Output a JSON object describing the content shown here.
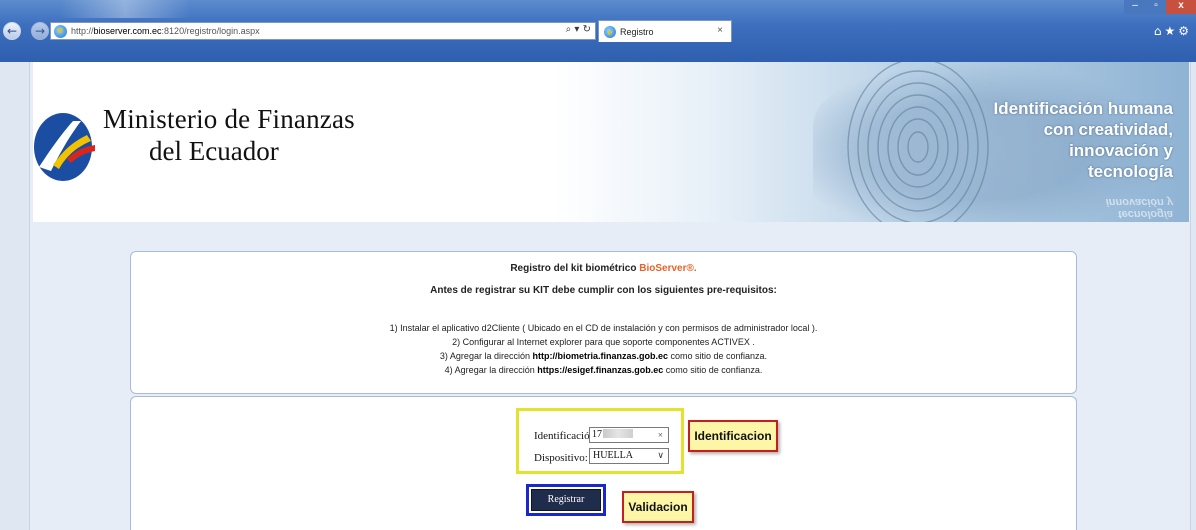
{
  "browser": {
    "url_prefix": "http://",
    "url_host": "bioserver.com.ec",
    "url_path": ":8120/registro/login.aspx",
    "address_tools": "⌕ ▾ ↻",
    "tab_title": "Registro",
    "tab_close": "×",
    "win_min": "–",
    "win_max": "▫",
    "win_close": "x",
    "right_icons": "⌂★⚙",
    "back": "←",
    "forward": "→",
    "ie_glyph": "e"
  },
  "banner": {
    "org_line1": "Ministerio de Finanzas",
    "org_line2": "del Ecuador",
    "tagline": [
      "Identificación humana",
      "con creatividad,",
      "innovación  y",
      "tecnología"
    ]
  },
  "info": {
    "title_prefix": "Registro del kit biométrico ",
    "title_brand": "BioServer®.",
    "subtitle": "Antes de registrar su KIT debe cumplir con los siguientes pre-requisitos:",
    "step1": "1) Instalar el aplicativo d2Cliente ( Ubicado en el CD de instalación y con permisos de administrador local ).",
    "step2": "2) Configurar al Internet explorer para que soporte componentes ACTIVEX .",
    "step3_pre": "3) Agregar la dirección ",
    "step3_url": "http://biometria.finanzas.gob.ec",
    "step3_post": " como sitio de confianza.",
    "step4_pre": "4) Agregar la dirección ",
    "step4_url": "https://esigef.finanzas.gob.ec",
    "step4_post": " como sitio de confianza."
  },
  "form": {
    "id_label": "Identificación:",
    "id_value": "17",
    "id_clear": "×",
    "device_label": "Dispositivo:",
    "device_value": "HUELLA",
    "device_chevron": "∨",
    "submit_label": "Registrar"
  },
  "annotations": {
    "id_callout": "Identificacion",
    "validate_callout": "Validacion"
  },
  "colors": {
    "brand_accent": "#e8632a",
    "highlight_yellow": "#e3e22c",
    "highlight_blue": "#1a27c9",
    "callout_border": "#c41e1e",
    "callout_fill": "#fcf6a6"
  }
}
